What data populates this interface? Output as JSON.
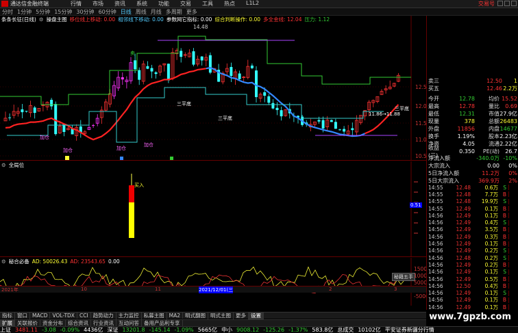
{
  "window": {
    "title": "通达信金融终端",
    "menu": [
      "行情",
      "市场",
      "资讯",
      "系统",
      "功能",
      "交易",
      "工具",
      "热点",
      "L1L2"
    ],
    "trade_label": "交易号"
  },
  "periods": {
    "items": [
      "分时",
      "1分钟",
      "5分钟",
      "15分钟",
      "30分钟",
      "60分钟",
      "日线",
      "周线",
      "月线",
      "多周期",
      "更多"
    ],
    "active_index": 6
  },
  "main_pane": {
    "indicator_name": "条条长征(日线)",
    "formula_label": "操盘主图",
    "line1": "移位线上移动: 0.00",
    "line2": "相邻线下移动: 0.00",
    "line3": "参数网它指标: 0.00",
    "line4": "综合判断操作: 0.00",
    "line5": "多全金线: 12.04",
    "line6": "压力: 1.12",
    "high_label": "14.48",
    "low_label": "10.39",
    "price_ticks": [
      "12.50",
      "12.00",
      "11.50",
      "11.00",
      "10.50"
    ],
    "annotations": [
      "三平底",
      "三平底",
      "三平底",
      "加仓",
      "加仓",
      "加仓",
      "加仓",
      "卖",
      "11.86→11.88"
    ]
  },
  "vol_pane": {
    "indicator_name": "全局位",
    "label": "买入",
    "value_tag": "0.51"
  },
  "ind_pane": {
    "indicator_name": "秘合必备",
    "ad_label": "AD: 50026.43",
    "ad2_label": "AD: 23543.65",
    "ad3_label": "0.00",
    "scale": [
      "15000",
      "10000",
      "5000",
      "0",
      "-5000"
    ],
    "button_label": "秘籍五手"
  },
  "xaxis": {
    "labels": [
      "2021年",
      "10",
      "11",
      "2021/12/01(三",
      "2",
      "3"
    ]
  },
  "right_panel": {
    "quote_rows": [
      {
        "label": "卖三",
        "value": "12.50",
        "count": "1",
        "color": "#ff3333"
      },
      {
        "label": "买五",
        "value": "12.46",
        "count": "2.2万",
        "color": "#ff3333"
      }
    ],
    "stats": [
      {
        "l1": "今开",
        "v1": "12.78",
        "l2": "均价",
        "v2": "15.52",
        "c1": "#33cc33",
        "c2": "#ff3333"
      },
      {
        "l1": "最高",
        "v1": "12.78",
        "l2": "量比",
        "v2": "0.69",
        "c1": "#ff3333",
        "c2": "#ff3333"
      },
      {
        "l1": "最低",
        "v1": "12.31",
        "l2": "市值",
        "v2": "27.9亿",
        "c1": "#33cc33",
        "c2": "#ffffff"
      },
      {
        "l1": "现量",
        "v1": "378",
        "l2": "总额",
        "v2": "26483",
        "c1": "#ffff33",
        "c2": "#ffff33"
      },
      {
        "l1": "外盘",
        "v1": "11856",
        "l2": "内盘",
        "v2": "14677",
        "c1": "#ff3333",
        "c2": "#33cc33"
      },
      {
        "l1": "换手",
        "v1": "1.19%",
        "l2": "股本",
        "v2": "2.23亿",
        "c1": "#ffffff",
        "c2": "#ffffff"
      },
      {
        "l1": "净资",
        "v1": "4.05",
        "l2": "流通",
        "v2": "2.22亿",
        "c1": "#ffffff",
        "c2": "#ffffff"
      },
      {
        "l1": "收益(三)",
        "v1": "0.350",
        "l2": "PE(动)",
        "v2": "26.7",
        "c1": "#ffffff",
        "c2": "#ffffff"
      }
    ],
    "flows": [
      {
        "label": "净流入额",
        "value": "-340.0万",
        "pct": "-10%",
        "color": "#33cc33"
      },
      {
        "label": "大宗流入",
        "value": "0.00",
        "pct": "0%",
        "color": "#ffffff"
      },
      {
        "label": "5日净流入额",
        "value": "11.2万",
        "pct": "0%",
        "color": "#ff3333"
      },
      {
        "label": "5日大宗流入",
        "value": "369.9万",
        "pct": "2%",
        "color": "#ff3333"
      }
    ],
    "ticks": [
      {
        "t": "14:55",
        "p": "12.48",
        "v": "0.6万",
        "d": "S",
        "dc": "#33cc33"
      },
      {
        "t": "14:55",
        "p": "12.48",
        "v": "7.7万",
        "d": "B",
        "dc": "#ff3333"
      },
      {
        "t": "14:55",
        "p": "12.48",
        "v": "19.9万",
        "d": "S",
        "dc": "#33cc33"
      },
      {
        "t": "14:55",
        "p": "12.49",
        "v": "0.1万",
        "d": "B",
        "dc": "#ff3333"
      },
      {
        "t": "14:56",
        "p": "12.49",
        "v": "0.1万",
        "d": "B",
        "dc": "#ff3333"
      },
      {
        "t": "14:56",
        "p": "12.49",
        "v": "0.4万",
        "d": "S",
        "dc": "#33cc33"
      },
      {
        "t": "14:56",
        "p": "12.49",
        "v": "3.5万",
        "d": "B",
        "dc": "#ff3333"
      },
      {
        "t": "14:56",
        "p": "12.49",
        "v": "0.3万",
        "d": "B",
        "dc": "#ff3333"
      },
      {
        "t": "14:56",
        "p": "12.49",
        "v": "0.1万",
        "d": "B",
        "dc": "#ff3333"
      },
      {
        "t": "14:56",
        "p": "12.49",
        "v": "0.2万",
        "d": "S",
        "dc": "#33cc33"
      },
      {
        "t": "14:56",
        "p": "12.48",
        "v": "0.2万",
        "d": "S",
        "dc": "#33cc33"
      },
      {
        "t": "14:56",
        "p": "12.49",
        "v": "0.2万",
        "d": "B",
        "dc": "#ff3333"
      },
      {
        "t": "14:56",
        "p": "12.49",
        "v": "0.1万",
        "d": "S",
        "dc": "#33cc33"
      },
      {
        "t": "14:56",
        "p": "12.49",
        "v": "0.5万",
        "d": "B",
        "dc": "#ff3333"
      },
      {
        "t": "14:56",
        "p": "12.50",
        "v": "0.4万",
        "d": "B",
        "dc": "#ff3333"
      },
      {
        "t": "14:56",
        "p": "12.49",
        "v": "0.1万",
        "d": "S",
        "dc": "#33cc33"
      },
      {
        "t": "14:56",
        "p": "12.49",
        "v": "0.1万",
        "d": "B",
        "dc": "#ff3333"
      },
      {
        "t": "14:56",
        "p": "12.49",
        "v": "0.1万",
        "d": "B",
        "dc": "#ff3333"
      }
    ]
  },
  "tabs": [
    "扩展",
    "关联报价",
    "资金分布",
    "综合资讯",
    "行业资讯",
    "互动问答",
    "备用产品利专享"
  ],
  "tabs2": [
    "指标",
    "窗口",
    "MACD",
    "VOL-TDX",
    "CCI",
    "趋势动力",
    "主力监控",
    "私募主图",
    "MA2",
    "明式翻图",
    "明式主图",
    "更多",
    "设置"
  ],
  "status": {
    "sh_label": "上证",
    "sh_value": "3481.11",
    "sh_chg": "-3.08",
    "sh_pct": "-0.09%",
    "sh_amt": "4436亿",
    "sz_label": "深证",
    "sz_value": "13201.8",
    "sz_chg": "-145.14",
    "sz_pct": "-1.09%",
    "sz_amt": "5665亿",
    "zx_label": "中小",
    "zx_value": "9008.12",
    "zx_chg": "-125.26",
    "zx_pct": "-1.37%",
    "zx_amt": "583.8亿",
    "total_label": "总成交",
    "total_value": "10102亿",
    "tail": "平安证券新疆分行情"
  },
  "watermark": "www.7gpzb.com"
}
